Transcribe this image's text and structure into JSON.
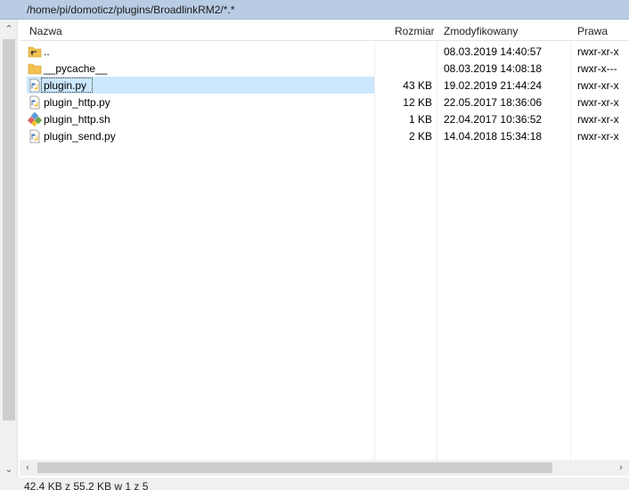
{
  "path": "/home/pi/domoticz/plugins/BroadlinkRM2/*.*",
  "columns": {
    "name": "Nazwa",
    "size": "Rozmiar",
    "modified": "Zmodyfikowany",
    "perms": "Prawa"
  },
  "files": [
    {
      "name": "..",
      "icon": "parent-folder-icon",
      "size": "",
      "modified": "08.03.2019 14:40:57",
      "perms": "rwxr-xr-x"
    },
    {
      "name": "__pycache__",
      "icon": "folder-icon",
      "size": "",
      "modified": "08.03.2019 14:08:18",
      "perms": "rwxr-x---"
    },
    {
      "name": "plugin.py",
      "icon": "python-file-icon",
      "size": "43 KB",
      "modified": "19.02.2019 21:44:24",
      "perms": "rwxr-xr-x"
    },
    {
      "name": "plugin_http.py",
      "icon": "python-file-icon",
      "size": "12 KB",
      "modified": "22.05.2017 18:36:06",
      "perms": "rwxr-xr-x"
    },
    {
      "name": "plugin_http.sh",
      "icon": "shell-script-icon",
      "size": "1 KB",
      "modified": "22.04.2017 10:36:52",
      "perms": "rwxr-xr-x"
    },
    {
      "name": "plugin_send.py",
      "icon": "python-file-icon",
      "size": "2 KB",
      "modified": "14.04.2018 15:34:18",
      "perms": "rwxr-xr-x"
    }
  ],
  "selected_index": 2,
  "status": "42,4 KB z 55,2 KB w 1 z 5",
  "colors": {
    "path_bar": "#b8cce4",
    "selection": "#cce8ff",
    "folder": "#f2c14e"
  }
}
